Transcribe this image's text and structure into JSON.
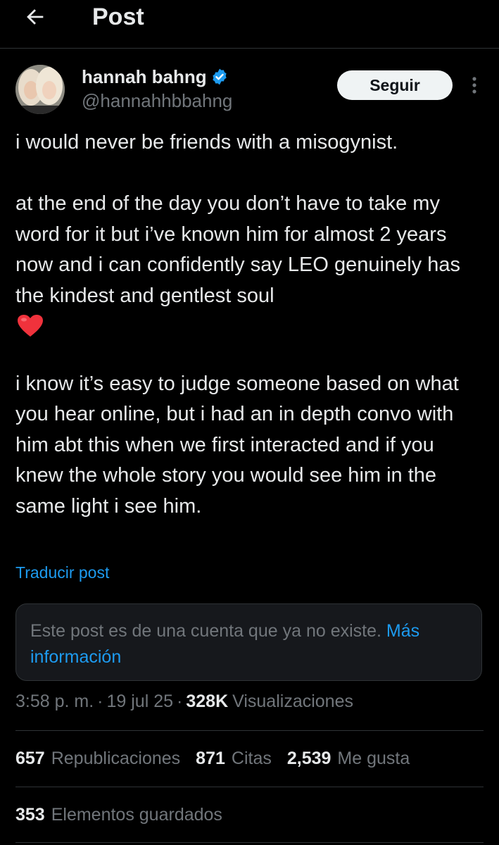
{
  "header": {
    "title": "Post"
  },
  "author": {
    "name": "hannah bahng",
    "handle": "@hannahhbbahng",
    "verified": true
  },
  "follow_label": "Seguir",
  "post": {
    "paragraph1": "i would never be friends with a misogynist.",
    "paragraph2": "at the end of the day you don’t have to take my word for it but i’ve known him for almost 2 years now and i can confidently say LEO genuinely has the kindest and gentlest soul",
    "paragraph3": "i know it’s easy to judge someone based on what you hear online, but i had an in depth convo with him abt this when we first interacted and if you knew the whole story you would see him in the same light i see him."
  },
  "translate_label": "Traducir post",
  "notice": {
    "text": "Este post es de una cuenta que ya no existe.",
    "link": "Más información"
  },
  "meta": {
    "time": "3:58 p. m.",
    "date": "19 jul 25",
    "views_count": "328K",
    "views_label": "Visualizaciones",
    "separator": "·"
  },
  "stats": {
    "reposts": {
      "count": "657",
      "label": "Republicaciones"
    },
    "quotes": {
      "count": "871",
      "label": "Citas"
    },
    "likes": {
      "count": "2,539",
      "label": "Me gusta"
    },
    "bookmarks": {
      "count": "353",
      "label": "Elementos guardados"
    }
  },
  "colors": {
    "background": "#000000",
    "text": "#e7e9ea",
    "secondary": "#71767b",
    "accent": "#1d9bf0",
    "heart": "#f91880"
  },
  "icons": [
    "back-arrow-icon",
    "verified-badge-icon",
    "more-options-icon",
    "red-heart-emoji"
  ]
}
